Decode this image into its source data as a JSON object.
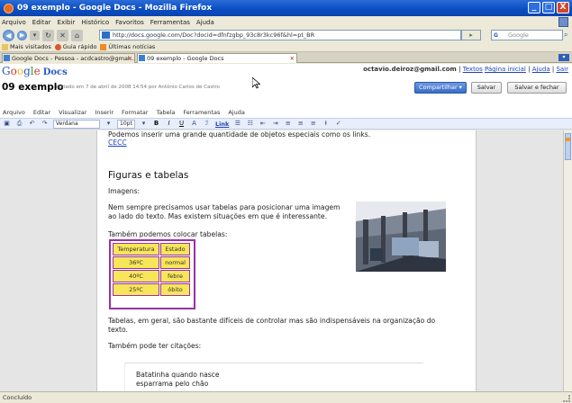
{
  "window": {
    "title": "09 exemplo - Google Docs - Mozilla Firefox",
    "buttons": [
      "_",
      "□",
      "X"
    ]
  },
  "browser_menu": [
    "Arquivo",
    "Editar",
    "Exibir",
    "Histórico",
    "Favoritos",
    "Ferramentas",
    "Ajuda"
  ],
  "nav": {
    "url": "http://docs.google.com/Doc?docid=dfnfzgbp_93c8r3kc96f&hl=pt_BR",
    "search_placeholder": "Google",
    "search_engine": "G"
  },
  "bookmarks": [
    "Mais visitados",
    "Guia rápido",
    "Últimas notícias"
  ],
  "tabs": [
    {
      "label": "Google Docs - Pessoa - acdcastro@gmai...",
      "active": false
    },
    {
      "label": "09 exemplo - Google Docs",
      "active": true
    }
  ],
  "docs": {
    "logo": {
      "g1": "G",
      "o1": "o",
      "o2": "o",
      "g2": "g",
      "l": "l",
      "e": "e",
      "docs": "Docs"
    },
    "user_email": "octavio.deiroz@gmail.com",
    "sep": "|",
    "links": [
      "Textos",
      "Página inicial",
      "Ajuda",
      "Sair"
    ],
    "title": "09 exemplo",
    "meta": "editado em 7 de abril de 2008 14:54 por Antônio Carlos de Castro",
    "share_label": "Compartilhar ▾",
    "save_label": "Salvar",
    "save_close_label": "Salvar e fechar"
  },
  "docs_menu": [
    "Arquivo",
    "Editar",
    "Visualizar",
    "Inserir",
    "Formatar",
    "Tabela",
    "Ferramentas",
    "Ajuda"
  ],
  "toolbar": {
    "font": "Verdana",
    "size": "10pt",
    "bold": "B",
    "italic": "I",
    "underline": "U",
    "text_color": "A",
    "highlight": "ℐ",
    "link": "Link"
  },
  "content": {
    "line_special": "Podemos inserir uma grande quantidade de objetos especiais como os links.",
    "link_text": "CECC",
    "heading": "Figuras e tabelas",
    "images_label": "Imagens:",
    "para1_line1": "Nem sempre precisamos usar tabelas para posicionar uma imagem",
    "para1_line2": "ao lado do texto. Mas existem situações em que é interessante.",
    "tables_label": "Também podemos colocar tabelas:",
    "table": {
      "headers": [
        "Temperatura",
        "Estado"
      ],
      "rows": [
        [
          "36ºC",
          "normal"
        ],
        [
          "40ºC",
          "febre"
        ],
        [
          "25ºC",
          "óbito"
        ]
      ]
    },
    "para2_line1": "Tabelas, em geral, são bastante difíceis de controlar mas são indispensáveis na organização do",
    "para2_line2": "texto.",
    "quotes_label": "Também pode ter citações:",
    "quote_line1": "Batatinha quando nasce",
    "quote_line2": "esparrama pelo chão"
  },
  "status": "Concluído"
}
